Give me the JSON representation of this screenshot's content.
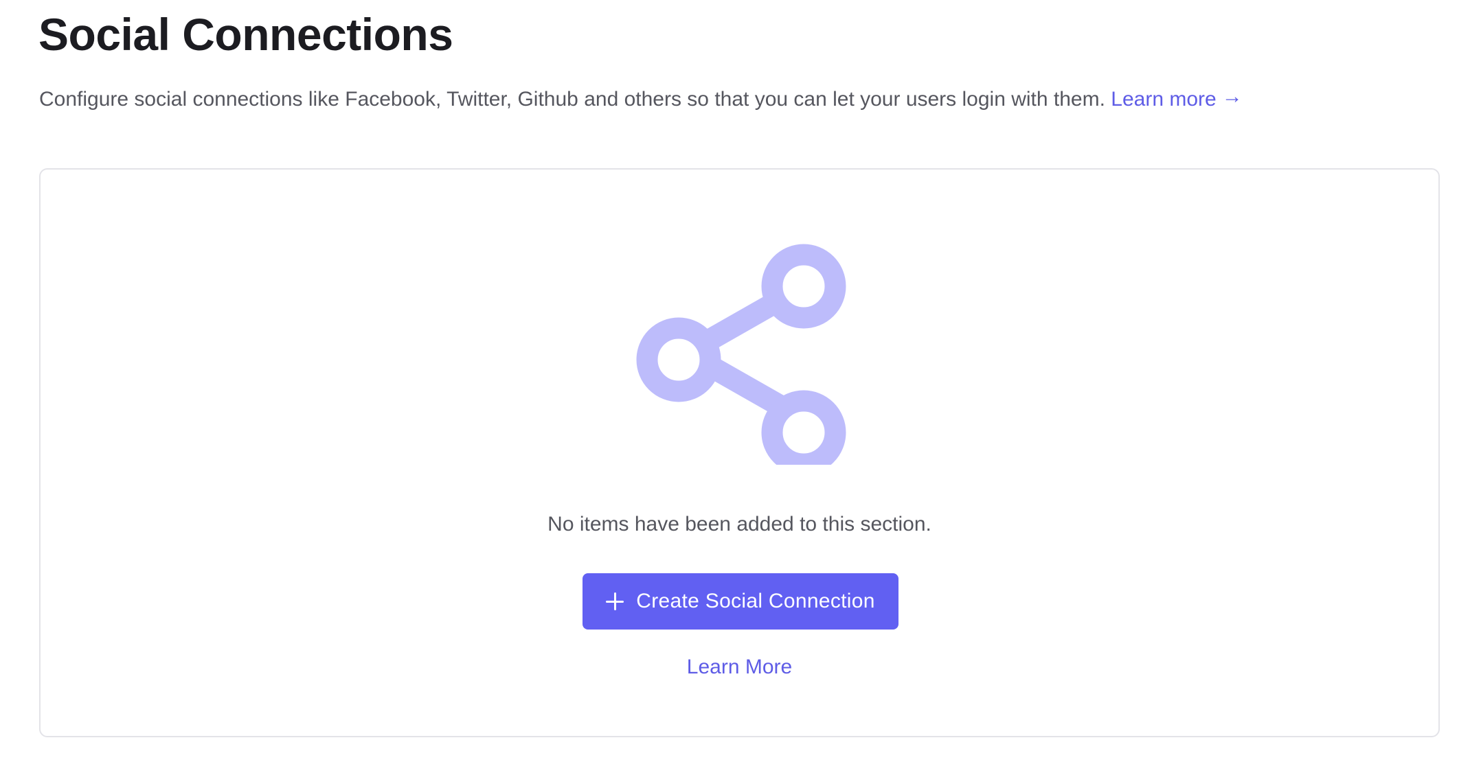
{
  "header": {
    "title": "Social Connections",
    "description": "Configure social connections like Facebook, Twitter, Github and others so that you can let your users login with them.",
    "learn_more_label": "Learn more",
    "learn_more_arrow": "→"
  },
  "empty_state": {
    "icon": "share-icon",
    "message": "No items have been added to this section.",
    "create_button_label": "Create Social Connection",
    "create_button_icon": "plus-icon",
    "learn_more_label": "Learn More"
  },
  "colors": {
    "accent": "#6160f2",
    "link": "#5e5ce6",
    "icon": "#bdbcfb",
    "text_muted": "#55565e",
    "title": "#1c1c21",
    "card_border": "#e3e3e8"
  }
}
